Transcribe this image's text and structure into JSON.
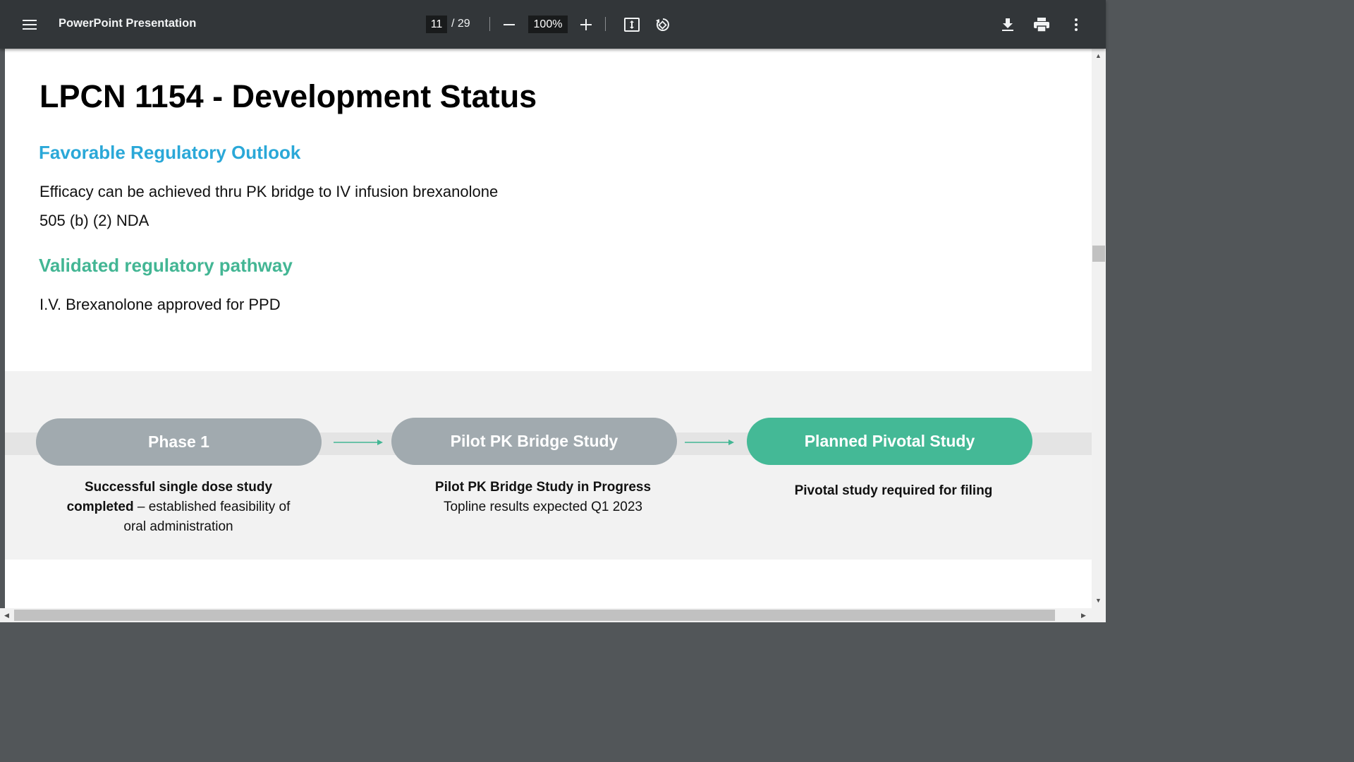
{
  "toolbar": {
    "title": "PowerPoint Presentation",
    "current_page": "11",
    "page_separator": "/ 29",
    "zoom": "100%",
    "icons": [
      "menu-icon",
      "zoom-out-icon",
      "zoom-in-icon",
      "fit-page-icon",
      "rotate-icon",
      "download-icon",
      "print-icon",
      "more-vert-icon"
    ]
  },
  "slide": {
    "title": "LPCN 1154 - Development Status",
    "section1_heading": "Favorable Regulatory Outlook",
    "section1_lines": [
      "Efficacy can be achieved thru PK bridge to IV infusion brexanolone",
      "505 (b) (2) NDA"
    ],
    "section2_heading": "Validated regulatory pathway",
    "section2_lines": [
      "I.V. Brexanolone  approved for PPD"
    ],
    "colors": {
      "blue_heading": "#2aa8d8",
      "green_heading": "#43b694",
      "grey_pill": "#a1aaaf",
      "green_pill": "#44b996"
    },
    "stages": [
      {
        "label": "Phase 1",
        "caption_bold_1": "Successful single dose study",
        "caption_bold_2": "completed",
        "caption_rest_2": " – established feasibility of",
        "caption_line_3": "oral administration"
      },
      {
        "label": "Pilot PK Bridge Study",
        "caption_bold_1": "Pilot PK Bridge Study in Progress",
        "caption_line_2": "Topline results expected Q1 2023"
      },
      {
        "label": "Planned Pivotal Study",
        "caption_bold_1": "Pivotal study required for filing"
      }
    ]
  }
}
